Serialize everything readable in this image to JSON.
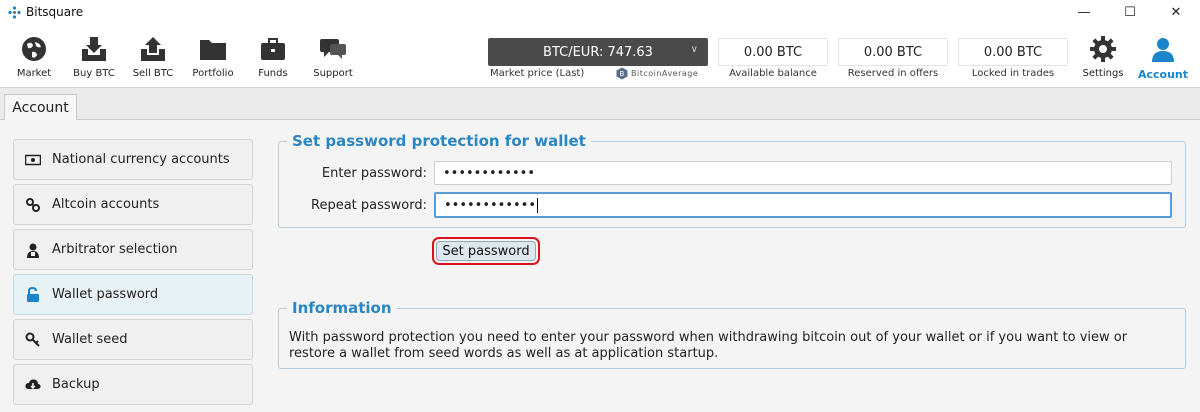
{
  "window": {
    "title": "Bitsquare",
    "controls": {
      "minimize": "—",
      "maximize": "☐",
      "close": "✕"
    }
  },
  "toolbar": {
    "nav": [
      {
        "label": "Market",
        "icon": "globe-icon"
      },
      {
        "label": "Buy BTC",
        "icon": "buy-btc-icon"
      },
      {
        "label": "Sell BTC",
        "icon": "sell-btc-icon"
      },
      {
        "label": "Portfolio",
        "icon": "folder-icon"
      },
      {
        "label": "Funds",
        "icon": "briefcase-icon"
      },
      {
        "label": "Support",
        "icon": "chat-icon"
      }
    ],
    "market_price": {
      "value": "BTC/EUR: 747.63",
      "label": "Market price (Last)",
      "provider": "BitcoinAverage"
    },
    "balances": [
      {
        "value": "0.00 BTC",
        "label": "Available balance"
      },
      {
        "value": "0.00 BTC",
        "label": "Reserved in offers"
      },
      {
        "value": "0.00 BTC",
        "label": "Locked in trades"
      }
    ],
    "settings_label": "Settings",
    "account_label": "Account",
    "accent": "#1a85c9"
  },
  "tab": {
    "label": "Account"
  },
  "sidebar": {
    "items": [
      {
        "label": "National currency accounts",
        "icon": "banknote-icon"
      },
      {
        "label": "Altcoin accounts",
        "icon": "link-icon"
      },
      {
        "label": "Arbitrator selection",
        "icon": "arbitrator-icon"
      },
      {
        "label": "Wallet password",
        "icon": "unlock-icon",
        "selected": true
      },
      {
        "label": "Wallet seed",
        "icon": "key-icon"
      },
      {
        "label": "Backup",
        "icon": "cloud-download-icon"
      }
    ]
  },
  "password_group": {
    "title": "Set password protection for wallet",
    "enter_label": "Enter password:",
    "enter_value": "••••••••••••",
    "repeat_label": "Repeat password:",
    "repeat_value": "••••••••••••",
    "submit_label": "Set password"
  },
  "info_group": {
    "title": "Information",
    "text": "With password protection you need to enter your password when withdrawing bitcoin out of your wallet or if you want to view or restore a wallet from seed words as well as at application startup."
  }
}
